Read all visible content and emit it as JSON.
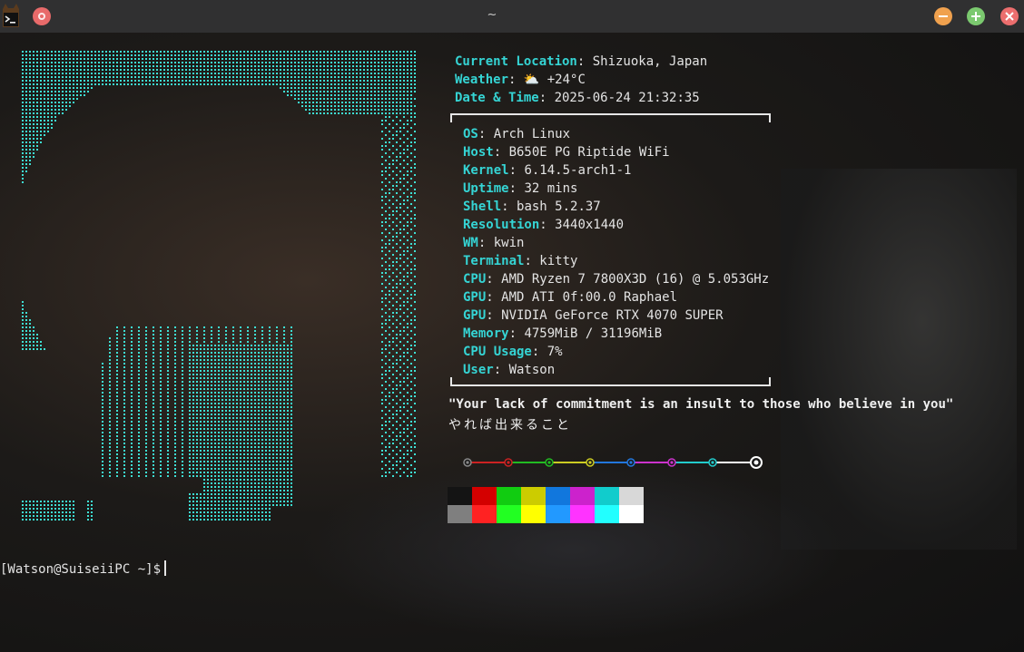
{
  "window": {
    "title": "~",
    "app_icon": "kitty-terminal-icon",
    "buttons": [
      "pin-icon",
      "minimize-icon",
      "maximize-icon",
      "close-icon"
    ]
  },
  "location": {
    "key": "Current Location",
    "value": "Shizuoka, Japan"
  },
  "weather": {
    "key": "Weather",
    "icon": "⛅",
    "value": "+24°C"
  },
  "datetime": {
    "key": "Date & Time",
    "value": "2025-06-24 21:32:35"
  },
  "sysinfo": [
    {
      "key": "OS",
      "value": "Arch Linux"
    },
    {
      "key": "Host",
      "value": "B650E PG Riptide WiFi"
    },
    {
      "key": "Kernel",
      "value": "6.14.5-arch1-1"
    },
    {
      "key": "Uptime",
      "value": "32 mins"
    },
    {
      "key": "Shell",
      "value": "bash 5.2.37"
    },
    {
      "key": "Resolution",
      "value": "3440x1440"
    },
    {
      "key": "WM",
      "value": "kwin"
    },
    {
      "key": "Terminal",
      "value": "kitty"
    },
    {
      "key": "CPU",
      "value": "AMD Ryzen 7 7800X3D (16) @ 5.053GHz"
    },
    {
      "key": "GPU",
      "value": "AMD ATI 0f:00.0 Raphael"
    },
    {
      "key": "GPU",
      "value": "NVIDIA GeForce RTX 4070 SUPER"
    },
    {
      "key": "Memory",
      "value": "4759MiB / 31196MiB"
    },
    {
      "key": "CPU Usage",
      "value": "7%"
    },
    {
      "key": "User",
      "value": "Watson"
    }
  ],
  "quote": "\"Your lack of commitment is an insult to those who believe in you\"",
  "jp_line": "やれば出来ること",
  "color_line": [
    "#888888",
    "#cc2222",
    "#22bb22",
    "#cccc22",
    "#2277dd",
    "#cc33cc",
    "#22cccc",
    "#ffffff"
  ],
  "palette": {
    "normal": [
      "#141414",
      "#d40000",
      "#11cc11",
      "#cccc00",
      "#1177dd",
      "#cc22cc",
      "#11cccc",
      "#d8d8d8"
    ],
    "bright": [
      "#7f7f7f",
      "#ff2222",
      "#22ff22",
      "#ffff00",
      "#2299ff",
      "#ff33ff",
      "#22ffff",
      "#ffffff"
    ]
  },
  "prompt": "[Watson@SuiseiiPC ~]$",
  "colors": {
    "key": "#35d4d4",
    "ascii": "#3ee0d4",
    "titlebar": "#303031"
  }
}
